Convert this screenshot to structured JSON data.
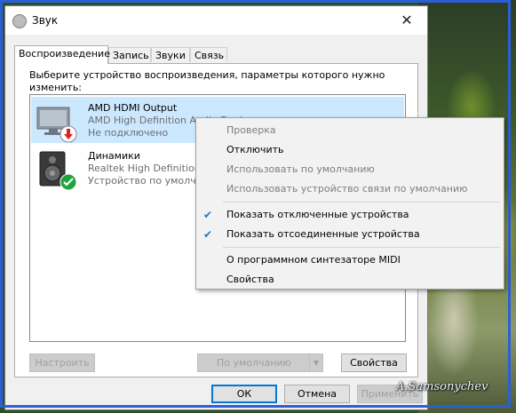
{
  "window": {
    "title": "Звук",
    "close_label": "✕"
  },
  "tabs": [
    {
      "label": "Воспроизведение"
    },
    {
      "label": "Запись"
    },
    {
      "label": "Звуки"
    },
    {
      "label": "Связь"
    }
  ],
  "panel": {
    "description": "Выберите устройство воспроизведения, параметры которого нужно изменить:"
  },
  "devices": [
    {
      "name": "AMD HDMI Output",
      "detail": "AMD High Definition Audio Device",
      "status": "Не подключено",
      "icon": "monitor-icon",
      "badge": "disconnected-badge-icon",
      "selected": true
    },
    {
      "name": "Динамики",
      "detail": "Realtek High Definition Audio",
      "status": "Устройство по умолчанию",
      "icon": "speaker-icon",
      "badge": "default-check-badge-icon",
      "selected": false
    }
  ],
  "context_menu": {
    "items": [
      {
        "label": "Проверка",
        "disabled": true,
        "checked": false
      },
      {
        "label": "Отключить",
        "disabled": false,
        "checked": false
      },
      {
        "label": "Использовать по умолчанию",
        "disabled": true,
        "checked": false
      },
      {
        "label": "Использовать устройство связи по умолчанию",
        "disabled": true,
        "checked": false
      },
      {
        "label": "Показать отключенные устройства",
        "disabled": false,
        "checked": true
      },
      {
        "label": "Показать отсоединенные устройства",
        "disabled": false,
        "checked": true
      },
      {
        "label": "О программном синтезаторе MIDI",
        "disabled": false,
        "checked": false
      },
      {
        "label": "Свойства",
        "disabled": false,
        "checked": false
      }
    ]
  },
  "buttons": {
    "configure": "Настроить",
    "default": "По умолчанию",
    "properties": "Свойства",
    "ok": "ОК",
    "cancel": "Отмена",
    "apply": "Применить"
  },
  "watermark": "A.Samsonychev",
  "colors": {
    "accent": "#0078d7",
    "selection": "#cce8ff",
    "frame": "#2a5fd8"
  }
}
